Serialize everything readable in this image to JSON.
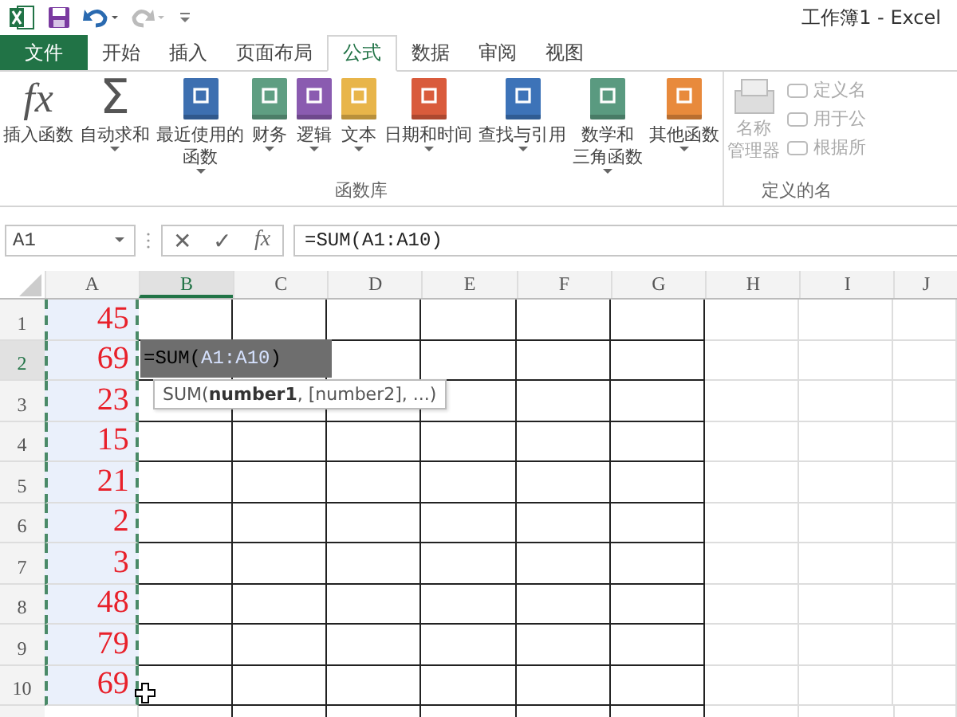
{
  "window": {
    "title": "工作簿1 - Excel"
  },
  "tabs": [
    {
      "label": "文件",
      "kind": "file",
      "selected": false
    },
    {
      "label": "开始",
      "kind": "tab",
      "selected": false
    },
    {
      "label": "插入",
      "kind": "tab",
      "selected": false
    },
    {
      "label": "页面布局",
      "kind": "tab",
      "selected": false
    },
    {
      "label": "公式",
      "kind": "tab",
      "selected": true
    },
    {
      "label": "数据",
      "kind": "tab",
      "selected": false
    },
    {
      "label": "审阅",
      "kind": "tab",
      "selected": false
    },
    {
      "label": "视图",
      "kind": "tab",
      "selected": false
    }
  ],
  "ribbon": {
    "groups": [
      {
        "label": "函数库",
        "items": [
          {
            "lines": [
              "插入函数"
            ],
            "glyph": "fx",
            "dropdown": false
          },
          {
            "lines": [
              "自动求和"
            ],
            "glyph": "Σ",
            "dropdown": true
          },
          {
            "lines": [
              "最近使用的",
              "函数"
            ],
            "color": "#3d6fb0",
            "dropdown": true
          },
          {
            "lines": [
              "财务"
            ],
            "color": "#5f9e82",
            "dropdown": true
          },
          {
            "lines": [
              "逻辑"
            ],
            "color": "#8a5bb0",
            "dropdown": true
          },
          {
            "lines": [
              "文本"
            ],
            "color": "#e8b54a",
            "dropdown": true
          },
          {
            "lines": [
              "日期和时间"
            ],
            "color": "#d95b3c",
            "dropdown": true
          },
          {
            "lines": [
              "查找与引用"
            ],
            "color": "#3d73b8",
            "dropdown": true
          },
          {
            "lines": [
              "数学和",
              "三角函数"
            ],
            "color": "#5a9a80",
            "dropdown": true
          },
          {
            "lines": [
              "其他函数"
            ],
            "color": "#e88a3c",
            "dropdown": true
          }
        ]
      },
      {
        "label": "定义的名",
        "big": {
          "lines": [
            "名称",
            "管理器"
          ],
          "disabled": true
        },
        "small": [
          {
            "label": "定义名",
            "disabled": true
          },
          {
            "label": "用于公",
            "disabled": true
          },
          {
            "label": "根据所",
            "disabled": true
          }
        ]
      }
    ]
  },
  "formula_bar": {
    "name_box": "A1",
    "buttons": [
      "✕",
      "✓",
      "fx"
    ],
    "formula": "=SUM(A1:A10)"
  },
  "grid": {
    "columns": [
      {
        "label": "A",
        "selected": false,
        "bordered": false,
        "marquee": true
      },
      {
        "label": "B",
        "selected": true,
        "bordered": true,
        "marquee": false
      },
      {
        "label": "C",
        "selected": false,
        "bordered": true,
        "marquee": false
      },
      {
        "label": "D",
        "selected": false,
        "bordered": true,
        "marquee": false
      },
      {
        "label": "E",
        "selected": false,
        "bordered": true,
        "marquee": false
      },
      {
        "label": "F",
        "selected": false,
        "bordered": true,
        "marquee": false
      },
      {
        "label": "G",
        "selected": false,
        "bordered": true,
        "marquee": false
      },
      {
        "label": "H",
        "selected": false,
        "bordered": false,
        "marquee": false
      },
      {
        "label": "I",
        "selected": false,
        "bordered": false,
        "marquee": false
      },
      {
        "label": "J",
        "selected": false,
        "bordered": false,
        "marquee": false
      }
    ],
    "rows": [
      {
        "label": "1",
        "selected": false,
        "value": "45"
      },
      {
        "label": "2",
        "selected": true,
        "value": "69"
      },
      {
        "label": "3",
        "selected": false,
        "value": "23"
      },
      {
        "label": "4",
        "selected": false,
        "value": "15"
      },
      {
        "label": "5",
        "selected": false,
        "value": "21"
      },
      {
        "label": "6",
        "selected": false,
        "value": "2"
      },
      {
        "label": "7",
        "selected": false,
        "value": "3"
      },
      {
        "label": "8",
        "selected": false,
        "value": "48"
      },
      {
        "label": "9",
        "selected": false,
        "value": "79"
      },
      {
        "label": "10",
        "selected": false,
        "value": "69"
      }
    ],
    "editor": {
      "parts": [
        {
          "text": "=SUM(",
          "kind": "plain"
        },
        {
          "text": "A1:A10",
          "kind": "ref"
        },
        {
          "text": ")",
          "kind": "plain"
        }
      ],
      "tooltip": "SUM(**number1**, [number2], ...)"
    }
  }
}
